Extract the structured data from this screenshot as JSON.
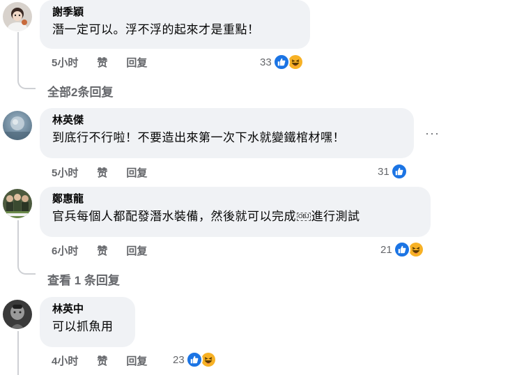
{
  "comments": [
    {
      "author": "謝季穎",
      "text": "潛一定可以。浮不浮的起來才是重點！",
      "time": "5小时",
      "like": "赞",
      "reply": "回复",
      "reaction_count": "33",
      "reactions": [
        "like-icon",
        "haha-icon"
      ],
      "replies_link": "全部2条回复"
    },
    {
      "author": "林英傑",
      "text": "到底行不行啦！不要造出來第一次下水就變鐵棺材嘿！",
      "time": "5小时",
      "like": "赞",
      "reply": "回复",
      "reaction_count": "31",
      "reactions": [
        "like-icon"
      ],
      "more": "···"
    },
    {
      "author": "鄭惠龍",
      "text_before": "官兵每個人都配發潛水裝備，然後就可以完成",
      "obj_glyph": "OBJ",
      "text_after": "進行測試",
      "time": "6小时",
      "like": "赞",
      "reply": "回复",
      "reaction_count": "21",
      "reactions": [
        "like-icon",
        "haha-icon"
      ],
      "replies_link": "查看 1 条回复"
    },
    {
      "author": "林英中",
      "text": "可以抓魚用",
      "time": "4小时",
      "like": "赞",
      "reply": "回复",
      "reaction_count": "23",
      "reactions": [
        "like-icon",
        "haha-icon"
      ]
    }
  ],
  "colors": {
    "bubble": "#f0f2f5",
    "meta_text": "#65676b",
    "like_blue": "#1b74e4",
    "haha_yellow": "#f7b125",
    "thread_line": "#ced0d4"
  }
}
